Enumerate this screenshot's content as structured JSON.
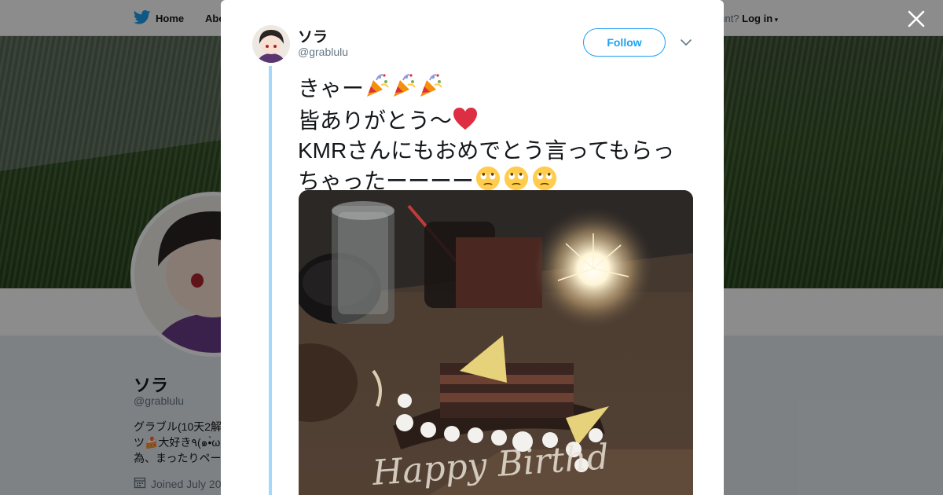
{
  "nav": {
    "home_label": "Home",
    "about_label": "Abo",
    "account_prompt": "ccount?",
    "login_label": "Log in"
  },
  "profile": {
    "name": "ソラ",
    "handle": "@grablulu",
    "bio_line1": "グラブル(10天2解",
    "bio_line2": "ツ🍰大好き٩(๑•̀ω",
    "bio_line3": "為、まったりペー",
    "joined": "Joined July 20"
  },
  "tweet": {
    "author_name": "ソラ",
    "author_handle": "@grablulu",
    "follow_label": "Follow",
    "text_line1": "きゃー",
    "text_line2": "皆ありがとう〜",
    "text_line3": "KMRさんにもおめでとう言ってもらっ",
    "text_line4": "ちゃったーーーー",
    "photo_text": "Happy Birthd"
  },
  "icons": {
    "twitter_bird": "twitter-bird-icon",
    "close": "close-icon",
    "caret": "chevron-down-icon",
    "calendar": "calendar-icon",
    "party_popper": "party-popper-icon",
    "heart": "red-heart-icon",
    "face": "rolling-eyes-face-icon"
  },
  "colors": {
    "brand_blue": "#1da1f2",
    "thread_line": "#a4d9f9",
    "text_primary": "#14171a",
    "text_secondary": "#657786",
    "heart_red": "#dd2e44"
  }
}
